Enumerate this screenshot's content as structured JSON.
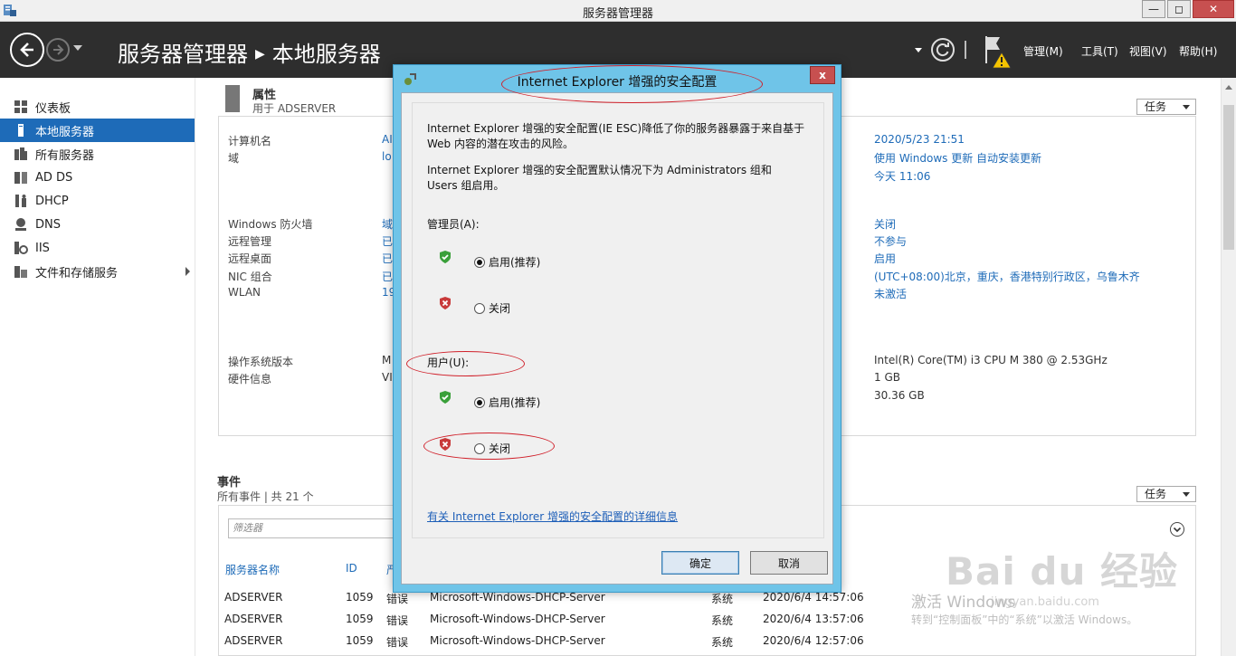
{
  "window": {
    "title": "服务器管理器",
    "min": "—",
    "max": "◻",
    "close": "✕"
  },
  "header": {
    "crumb_root": "服务器管理器",
    "crumb_sep": "▶",
    "crumb_current": "本地服务器",
    "menus": [
      "管理(M)",
      "工具(T)",
      "视图(V)",
      "帮助(H)"
    ]
  },
  "sidebar": {
    "items": [
      {
        "label": "仪表板",
        "icon": "dashboard-icon"
      },
      {
        "label": "本地服务器",
        "icon": "local-server-icon"
      },
      {
        "label": "所有服务器",
        "icon": "all-servers-icon"
      },
      {
        "label": "AD DS",
        "icon": "adds-icon"
      },
      {
        "label": "DHCP",
        "icon": "dhcp-icon"
      },
      {
        "label": "DNS",
        "icon": "dns-icon"
      },
      {
        "label": "IIS",
        "icon": "iis-icon"
      },
      {
        "label": "文件和存储服务",
        "icon": "file-storage-icon"
      }
    ]
  },
  "properties": {
    "title": "属性",
    "subtitle": "用于 ADSERVER",
    "tasks_label": "任务",
    "left_labels": [
      "计算机名",
      "域",
      "Windows 防火墙",
      "远程管理",
      "远程桌面",
      "NIC 组合",
      "WLAN",
      "操作系统版本",
      "硬件信息"
    ],
    "left_values": [
      "AI",
      "lo",
      "域",
      "已",
      "已",
      "已",
      "19",
      "M",
      "VI"
    ],
    "right_values": [
      "2020/5/23 21:51",
      "使用 Windows 更新 自动安装更新",
      "今天 11:06",
      "关闭",
      "不参与",
      "启用",
      "(UTC+08:00)北京，重庆，香港特别行政区，乌鲁木齐",
      "未激活",
      "Intel(R) Core(TM) i3 CPU       M 380  @ 2.53GHz",
      "1 GB",
      "30.36 GB"
    ]
  },
  "events": {
    "title": "事件",
    "subtitle": "所有事件 | 共 21 个",
    "tasks_label": "任务",
    "filter_placeholder": "筛选器",
    "columns": [
      "服务器名称",
      "ID",
      "严"
    ],
    "rows": [
      [
        "ADSERVER",
        "1059",
        "错误",
        "Microsoft-Windows-DHCP-Server",
        "系统",
        "2020/6/4 14:57:06"
      ],
      [
        "ADSERVER",
        "1059",
        "错误",
        "Microsoft-Windows-DHCP-Server",
        "系统",
        "2020/6/4 13:57:06"
      ],
      [
        "ADSERVER",
        "1059",
        "错误",
        "Microsoft-Windows-DHCP-Server",
        "系统",
        "2020/6/4 12:57:06"
      ]
    ]
  },
  "watermark": {
    "activate_title": "激活 Windows",
    "activate_sub": "转到“控制面板”中的“系统”以激活 Windows。",
    "logo": "Bai du 经验",
    "url": "jingyan.baidu.com"
  },
  "dialog": {
    "title": "Internet Explorer 增强的安全配置",
    "close": "x",
    "para1_line1": "Internet Explorer 增强的安全配置(IE ESC)降低了你的服务器暴露于来自基于",
    "para1_line2": "Web 内容的潜在攻击的风险。",
    "para2_line1": "Internet Explorer 增强的安全配置默认情况下为 Administrators 组和",
    "para2_line2": "Users 组启用。",
    "admin_label": "管理员(A):",
    "admin_on": "启用(推荐)",
    "admin_off": "关闭",
    "users_label": "用户(U):",
    "users_on": "启用(推荐)",
    "users_off": "关闭",
    "link": "有关 Internet Explorer 增强的安全配置的详细信息",
    "ok": "确定",
    "cancel": "取消"
  },
  "colors": {
    "accent": "#1e6bb8",
    "header_bg": "#2e2e2e",
    "dialog_frame": "#6fc4e8",
    "annotation": "#d0202a"
  }
}
